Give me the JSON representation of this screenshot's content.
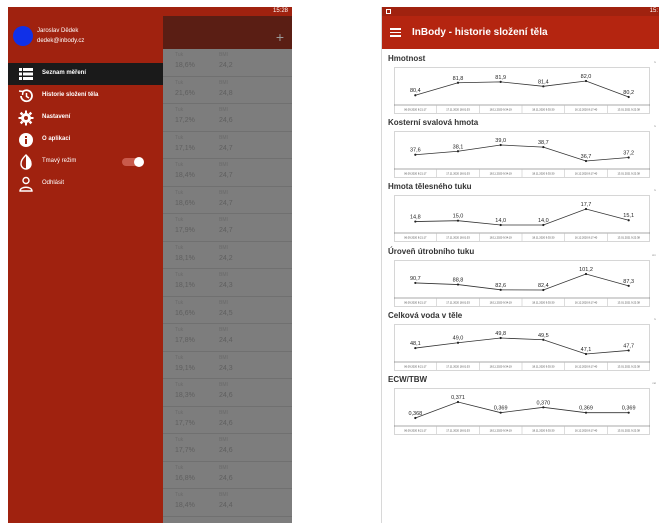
{
  "left_phone": {
    "status_bar": {
      "time": "15:28"
    },
    "appbar": {
      "add_icon": "plus-icon"
    },
    "list": {
      "headers": {
        "col1": "Tuk",
        "col2": "BMI"
      },
      "rows": [
        {
          "tuk": "18,6%",
          "bmi": "24,2"
        },
        {
          "tuk": "21,6%",
          "bmi": "24,8"
        },
        {
          "tuk": "17,2%",
          "bmi": "24,6"
        },
        {
          "tuk": "17,1%",
          "bmi": "24,7"
        },
        {
          "tuk": "18,4%",
          "bmi": "24,7"
        },
        {
          "tuk": "18,6%",
          "bmi": "24,7"
        },
        {
          "tuk": "17,9%",
          "bmi": "24,7"
        },
        {
          "tuk": "18,1%",
          "bmi": "24,2"
        },
        {
          "tuk": "18,1%",
          "bmi": "24,3"
        },
        {
          "tuk": "16,6%",
          "bmi": "24,5"
        },
        {
          "tuk": "17,8%",
          "bmi": "24,4"
        },
        {
          "tuk": "19,1%",
          "bmi": "24,3"
        },
        {
          "tuk": "18,3%",
          "bmi": "24,6"
        },
        {
          "tuk": "17,7%",
          "bmi": "24,6"
        },
        {
          "tuk": "17,7%",
          "bmi": "24,6"
        },
        {
          "tuk": "16,8%",
          "bmi": "24,6"
        },
        {
          "tuk": "18,4%",
          "bmi": "24,4"
        }
      ]
    },
    "drawer": {
      "user_name": "Jaroslav Dědek",
      "user_email": "dedek@inbody.cz",
      "items": [
        {
          "label": "Seznam měření",
          "icon": "list-icon",
          "active": true
        },
        {
          "label": "Historie složení těla",
          "icon": "history-icon",
          "active": false
        },
        {
          "label": "Nastavení",
          "icon": "gear-icon",
          "active": false
        },
        {
          "label": "O aplikaci",
          "icon": "info-icon",
          "active": false
        },
        {
          "label": "Tmavý režim",
          "icon": "contrast-icon",
          "active": false,
          "toggle": true
        },
        {
          "label": "Odhlásit",
          "icon": "person-icon",
          "active": false
        }
      ]
    }
  },
  "right_tablet": {
    "status_bar": {
      "time": "15:"
    },
    "appbar": {
      "title": "InBody - historie složení těla",
      "menu_icon": "hamburger-icon"
    },
    "dates": [
      "06.09.2020 8:21:17",
      "17.11.2020 18:01:53",
      "18.11.2020 9:34:19",
      "18.11.2020 9:35:30",
      "16.12.2020 8:17:40",
      "13.01.2021 9:22:38"
    ],
    "charts": [
      {
        "title": "Hmotnost",
        "unit": "k",
        "type": "line",
        "values": [
          80.4,
          81.8,
          81.9,
          81.4,
          82.0,
          80.2
        ],
        "labels": [
          "80,4",
          "81,8",
          "81,9",
          "81,4",
          "82,0",
          "80,2"
        ]
      },
      {
        "title": "Kosterní svalová hmota",
        "unit": "k",
        "type": "line",
        "values": [
          37.6,
          38.1,
          39.0,
          38.7,
          36.7,
          37.2
        ],
        "labels": [
          "37,6",
          "38,1",
          "39,0",
          "38,7",
          "36,7",
          "37,2"
        ]
      },
      {
        "title": "Hmota tělesného tuku",
        "unit": "k",
        "type": "line",
        "values": [
          14.8,
          15.0,
          14.0,
          14.0,
          17.7,
          15.1
        ],
        "labels": [
          "14,8",
          "15,0",
          "14,0",
          "14,0",
          "17,7",
          "15,1"
        ]
      },
      {
        "title": "Úroveň útrobního tuku",
        "unit": "cm",
        "type": "line",
        "values": [
          90.7,
          88.8,
          82.6,
          82.4,
          101.2,
          87.3
        ],
        "labels": [
          "90,7",
          "88,8",
          "82,6",
          "82,4",
          "101,2",
          "87,3"
        ]
      },
      {
        "title": "Celková voda v těle",
        "unit": "k",
        "type": "line",
        "values": [
          48.1,
          49.0,
          49.8,
          49.5,
          47.1,
          47.7
        ],
        "labels": [
          "48,1",
          "49,0",
          "49,8",
          "49,5",
          "47,1",
          "47,7"
        ]
      },
      {
        "title": "ECW/TBW",
        "unit": "rat",
        "type": "line",
        "values": [
          0.368,
          0.371,
          0.369,
          0.37,
          0.369,
          0.369
        ],
        "labels": [
          "0,368",
          "0,371",
          "0,369",
          "0,370",
          "0,369",
          "0,369"
        ]
      }
    ]
  },
  "colors": {
    "primary": "#b42510",
    "drawer": "#a0220f",
    "dim": "#7d7d7d",
    "avatar": "#1030e8"
  }
}
